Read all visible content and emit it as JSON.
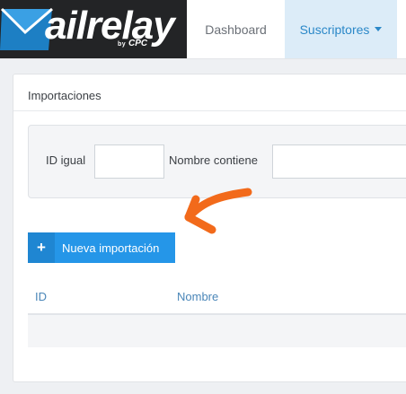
{
  "app": {
    "logo_text": "ailrelay",
    "logo_by": "by",
    "logo_brand": "CPC"
  },
  "nav": {
    "dashboard": "Dashboard",
    "subscribers": "Suscriptores"
  },
  "panel": {
    "title": "Importaciones"
  },
  "filters": {
    "id_label": "ID igual",
    "id_value": "",
    "name_label": "Nombre contiene",
    "name_value": ""
  },
  "actions": {
    "new_import": "Nueva importación"
  },
  "table": {
    "columns": [
      "ID",
      "Nombre"
    ],
    "rows": []
  },
  "colors": {
    "accent": "#2596e8",
    "annotation_arrow": "#f26a1b",
    "logo_bg": "#232426"
  },
  "icons": [
    "envelope-icon",
    "plus-icon",
    "caret-down-icon",
    "annotation-arrow-icon"
  ]
}
